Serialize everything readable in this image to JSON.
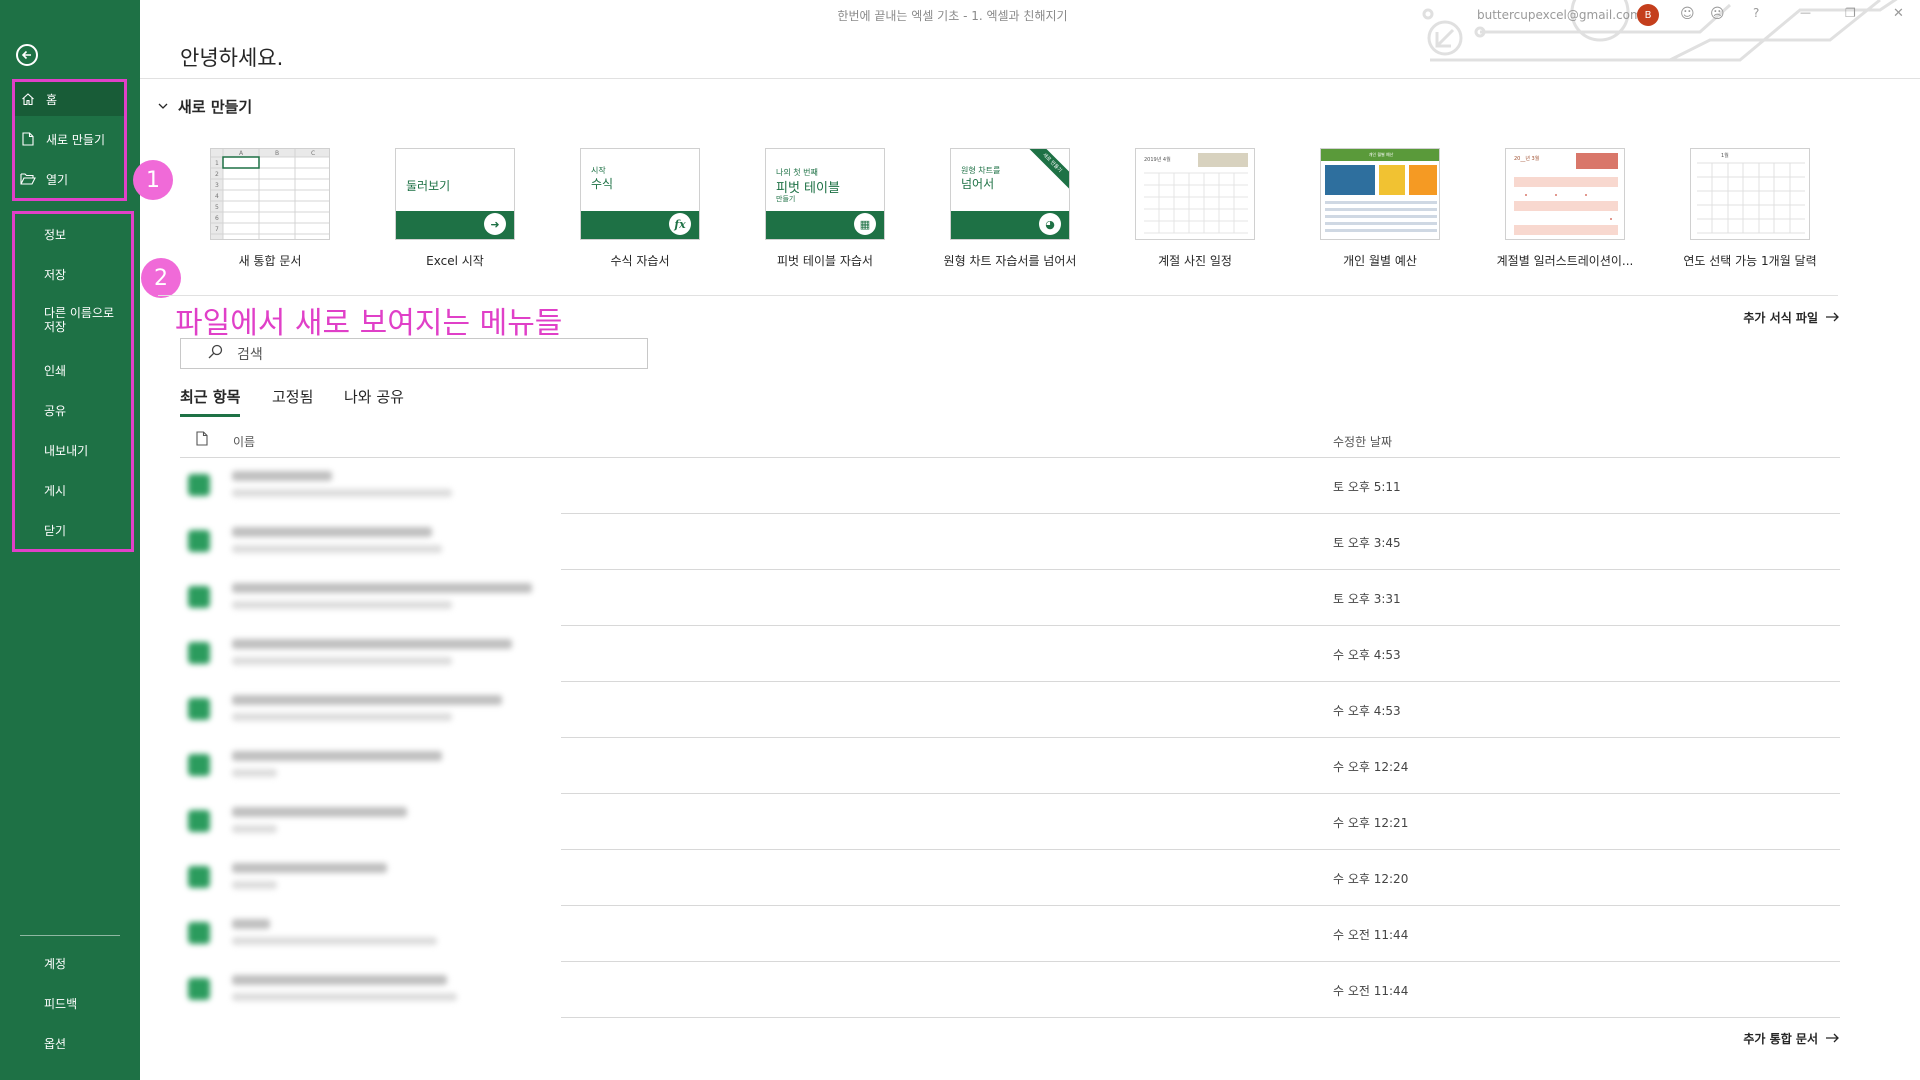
{
  "window": {
    "title": "한번에 끝내는 엑셀 기초 - 1. 엑셀과 친해지기",
    "account_email": "buttercupexcel@gmail.com",
    "avatar_initial": "B",
    "help": "?",
    "minimize": "—",
    "restore": "❐",
    "close": "✕"
  },
  "sidebar": {
    "back_icon": "back-arrow-icon",
    "top_items": [
      {
        "label": "홈",
        "icon": "home-icon",
        "active": true
      },
      {
        "label": "새로 만들기",
        "icon": "new-document-icon"
      },
      {
        "label": "열기",
        "icon": "open-folder-icon"
      }
    ],
    "file_items": [
      {
        "label": "정보"
      },
      {
        "label": "저장"
      },
      {
        "label": "다른 이름으로 저장"
      },
      {
        "label": "인쇄"
      },
      {
        "label": "공유"
      },
      {
        "label": "내보내기"
      },
      {
        "label": "게시"
      },
      {
        "label": "닫기"
      }
    ],
    "bottom_items": [
      {
        "label": "계정"
      },
      {
        "label": "피드백"
      },
      {
        "label": "옵션"
      }
    ]
  },
  "annotations": {
    "badge_1": "1",
    "badge_2": "2",
    "caption": "파일에서 새로 보여지는 메뉴들",
    "color": "#e040c8"
  },
  "main": {
    "greeting": "안녕하세요.",
    "new_section_title": "새로 만들기",
    "templates": [
      {
        "label": "새 통합 문서"
      },
      {
        "label": "Excel 시작",
        "thumb_text": "둘러보기"
      },
      {
        "label": "수식 자습서",
        "thumb_small": "시작",
        "thumb_text": "수식"
      },
      {
        "label": "피벗 테이블 자습서",
        "thumb_small": "나의 첫 번째",
        "thumb_text": "피벗 테이블",
        "thumb_small2": "만들기"
      },
      {
        "label": "원형 차트 자습서를 넘어서",
        "thumb_small": "원형 차트를",
        "thumb_text": "넘어서",
        "ribbon": "새로 만들기"
      },
      {
        "label": "계절 사진 일정",
        "thumb_small": "2019년 4월"
      },
      {
        "label": "개인 월별 예산",
        "thumb_small": "개인 월별 예산"
      },
      {
        "label": "계절별 일러스트레이션이...",
        "thumb_small": "20__년 3월"
      },
      {
        "label": "연도 선택 가능 1개월 달력",
        "thumb_small": "1월"
      }
    ],
    "more_templates": "추가 서식 파일",
    "search_placeholder": "검색",
    "tabs": [
      {
        "label": "최근 항목",
        "active": true
      },
      {
        "label": "고정됨"
      },
      {
        "label": "나와 공유"
      }
    ],
    "columns": {
      "name": "이름",
      "modified": "수정한 날짜"
    },
    "files": [
      {
        "modified": "토 오후 5:11"
      },
      {
        "modified": "토 오후 3:45"
      },
      {
        "modified": "토 오후 3:31"
      },
      {
        "modified": "수 오후 4:53"
      },
      {
        "modified": "수 오후 4:53"
      },
      {
        "modified": "수 오후 12:24"
      },
      {
        "modified": "수 오후 12:21"
      },
      {
        "modified": "수 오후 12:20"
      },
      {
        "modified": "수 오전 11:44"
      },
      {
        "modified": "수 오전 11:44"
      }
    ],
    "more_documents": "추가 통합 문서"
  },
  "colors": {
    "sidebar": "#1e7145",
    "sidebar_active": "#185c37",
    "accent": "#1e7145"
  }
}
